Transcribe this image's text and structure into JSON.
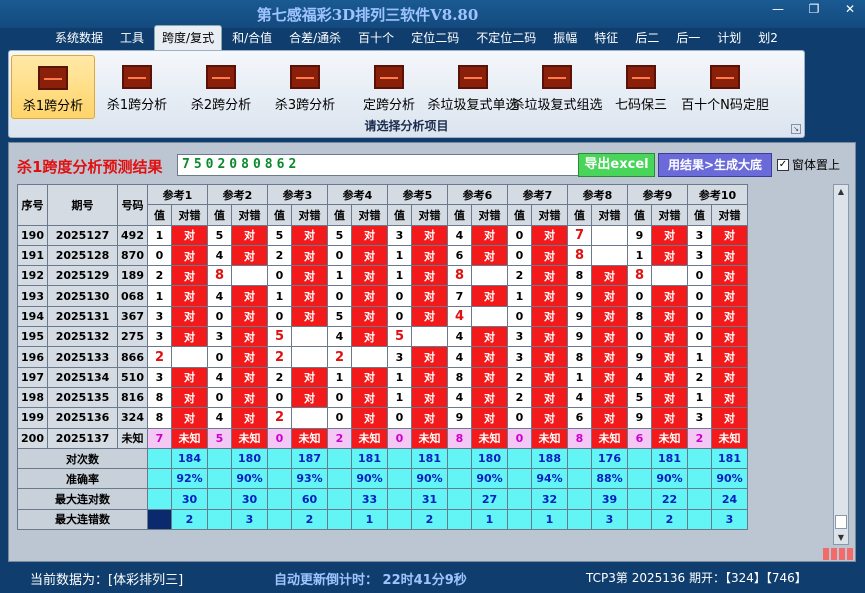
{
  "window": {
    "title": "第七感福彩3D排列三软件V8.80",
    "buttons": [
      "—",
      "❐",
      "✕"
    ]
  },
  "menu": [
    "系统数据",
    "工具",
    "跨度/复式",
    "和/合值",
    "合差/通杀",
    "百十个",
    "定位二码",
    "不定位二码",
    "振幅",
    "特征",
    "后二",
    "后一",
    "计划",
    "划2"
  ],
  "menu_active": 2,
  "ribbon": {
    "buttons": [
      "杀1跨分析",
      "杀1跨分析",
      "杀2跨分析",
      "杀3跨分析",
      "定跨分析",
      "杀垃圾复式单选",
      "杀垃圾复式组选",
      "七码保三",
      "百十个N码定胆"
    ],
    "selected": 0,
    "caption": "请选择分析项目"
  },
  "result": {
    "title": "杀1跨度分析预测结果",
    "value": "7502080862",
    "excel_label": "导出excel",
    "gen_label": "用结果>生成大底",
    "topmost_label": "窗体置上",
    "topmost_checked": true
  },
  "table": {
    "head_left": [
      "序号",
      "期号",
      "号码"
    ],
    "ref_titles": [
      "参考1",
      "参考2",
      "参考3",
      "参考4",
      "参考5",
      "参考6",
      "参考7",
      "参考8",
      "参考9",
      "参考10"
    ],
    "sub_val": "值",
    "sub_ok": "对错",
    "ok_text": "对",
    "unknown_text": "未知",
    "rows": [
      {
        "seq": "190",
        "period": "2025127",
        "code": "492",
        "vals": [
          "1",
          "5",
          "5",
          "5",
          "3",
          "4",
          "0",
          "7",
          "9",
          "3"
        ],
        "hits": [
          1,
          1,
          1,
          1,
          1,
          1,
          1,
          0,
          1,
          1
        ],
        "red": [
          0,
          0,
          0,
          0,
          0,
          0,
          0,
          1,
          0,
          0
        ]
      },
      {
        "seq": "191",
        "period": "2025128",
        "code": "870",
        "vals": [
          "0",
          "4",
          "2",
          "0",
          "1",
          "6",
          "0",
          "8",
          "1",
          "3"
        ],
        "hits": [
          1,
          1,
          1,
          1,
          1,
          1,
          1,
          0,
          1,
          1
        ],
        "red": [
          0,
          0,
          0,
          0,
          0,
          0,
          0,
          1,
          0,
          0
        ]
      },
      {
        "seq": "192",
        "period": "2025129",
        "code": "189",
        "vals": [
          "2",
          "8",
          "0",
          "1",
          "1",
          "8",
          "2",
          "8",
          "8",
          "0"
        ],
        "hits": [
          1,
          0,
          1,
          1,
          1,
          0,
          1,
          1,
          0,
          1
        ],
        "red": [
          0,
          1,
          0,
          0,
          0,
          1,
          0,
          0,
          1,
          0
        ]
      },
      {
        "seq": "193",
        "period": "2025130",
        "code": "068",
        "vals": [
          "1",
          "4",
          "1",
          "0",
          "0",
          "7",
          "1",
          "9",
          "0",
          "0"
        ],
        "hits": [
          1,
          1,
          1,
          1,
          1,
          1,
          1,
          1,
          1,
          1
        ],
        "red": [
          0,
          0,
          0,
          0,
          0,
          0,
          0,
          0,
          0,
          0
        ]
      },
      {
        "seq": "194",
        "period": "2025131",
        "code": "367",
        "vals": [
          "3",
          "0",
          "0",
          "5",
          "0",
          "4",
          "0",
          "9",
          "8",
          "0"
        ],
        "hits": [
          1,
          1,
          1,
          1,
          1,
          0,
          1,
          1,
          1,
          1
        ],
        "red": [
          0,
          0,
          0,
          0,
          0,
          1,
          0,
          0,
          0,
          0
        ]
      },
      {
        "seq": "195",
        "period": "2025132",
        "code": "275",
        "vals": [
          "3",
          "3",
          "5",
          "4",
          "5",
          "4",
          "3",
          "9",
          "0",
          "0"
        ],
        "hits": [
          1,
          1,
          0,
          1,
          0,
          1,
          1,
          1,
          1,
          1
        ],
        "red": [
          0,
          0,
          1,
          0,
          1,
          0,
          0,
          0,
          0,
          0
        ]
      },
      {
        "seq": "196",
        "period": "2025133",
        "code": "866",
        "vals": [
          "2",
          "0",
          "2",
          "2",
          "3",
          "4",
          "3",
          "8",
          "9",
          "1"
        ],
        "hits": [
          0,
          1,
          0,
          0,
          1,
          1,
          1,
          1,
          1,
          1
        ],
        "red": [
          1,
          0,
          1,
          1,
          0,
          0,
          0,
          0,
          0,
          0
        ]
      },
      {
        "seq": "197",
        "period": "2025134",
        "code": "510",
        "vals": [
          "3",
          "4",
          "2",
          "1",
          "1",
          "8",
          "2",
          "1",
          "4",
          "2"
        ],
        "hits": [
          1,
          1,
          1,
          1,
          1,
          1,
          1,
          1,
          1,
          1
        ],
        "red": [
          0,
          0,
          0,
          0,
          0,
          0,
          0,
          0,
          0,
          0
        ]
      },
      {
        "seq": "198",
        "period": "2025135",
        "code": "816",
        "vals": [
          "8",
          "0",
          "0",
          "0",
          "1",
          "4",
          "2",
          "4",
          "5",
          "1"
        ],
        "hits": [
          1,
          1,
          1,
          1,
          1,
          1,
          1,
          1,
          1,
          1
        ],
        "red": [
          0,
          0,
          0,
          0,
          0,
          0,
          0,
          0,
          0,
          0
        ]
      },
      {
        "seq": "199",
        "period": "2025136",
        "code": "324",
        "vals": [
          "8",
          "4",
          "2",
          "0",
          "0",
          "9",
          "0",
          "6",
          "9",
          "3"
        ],
        "hits": [
          1,
          1,
          0,
          1,
          1,
          1,
          1,
          1,
          1,
          1
        ],
        "red": [
          0,
          0,
          1,
          0,
          0,
          0,
          0,
          0,
          0,
          0
        ]
      },
      {
        "seq": "200",
        "period": "2025137",
        "code": "未知",
        "vals": [
          "7",
          "5",
          "0",
          "2",
          "0",
          "8",
          "0",
          "8",
          "6",
          "2"
        ],
        "hits": [
          2,
          2,
          2,
          2,
          2,
          2,
          2,
          2,
          2,
          2
        ],
        "red": [
          0,
          0,
          0,
          0,
          0,
          0,
          0,
          0,
          0,
          0
        ]
      }
    ],
    "stats": [
      {
        "label": "对次数",
        "values": [
          "184",
          "180",
          "187",
          "181",
          "181",
          "180",
          "188",
          "176",
          "181",
          "181"
        ]
      },
      {
        "label": "准确率",
        "values": [
          "92%",
          "90%",
          "93%",
          "90%",
          "90%",
          "90%",
          "94%",
          "88%",
          "90%",
          "90%"
        ]
      },
      {
        "label": "最大连对数",
        "values": [
          "30",
          "30",
          "60",
          "33",
          "31",
          "27",
          "32",
          "39",
          "22",
          "24"
        ]
      },
      {
        "label": "最大连错数",
        "values": [
          "2",
          "3",
          "2",
          "1",
          "2",
          "1",
          "1",
          "3",
          "2",
          "3"
        ]
      }
    ]
  },
  "status": {
    "left": "当前数据为：[体彩排列三]",
    "middle": "自动更新倒计时： 22时41分9秒",
    "right": "TCP3第 2025136 期开：【324】【746】"
  }
}
